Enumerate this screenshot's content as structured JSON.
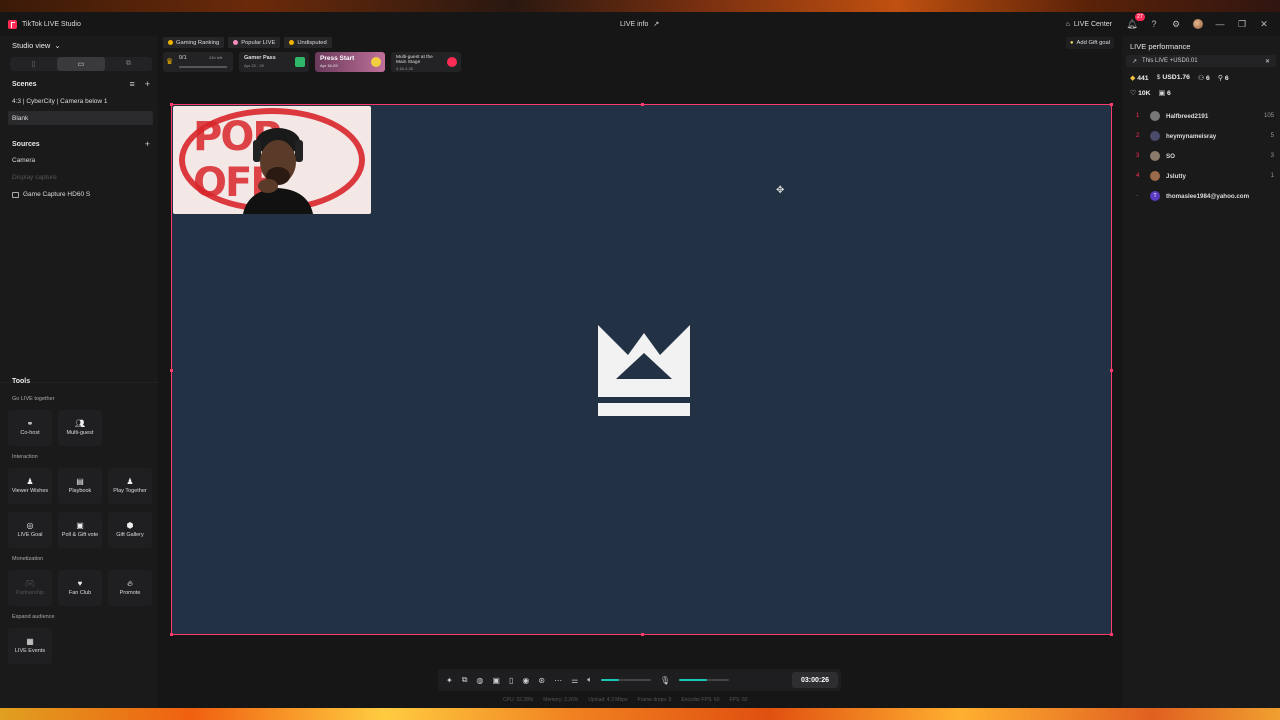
{
  "app": {
    "title": "TikTok LIVE Studio",
    "center_title": "LIVE info"
  },
  "titlebar": {
    "live_center": "LIVE Center",
    "notification_count": "27"
  },
  "sidebar": {
    "studio_view": "Studio view",
    "scenes_title": "Scenes",
    "scenes": [
      "4:3 | CyberCity | Camera below 1",
      "Blank"
    ],
    "sources_title": "Sources",
    "sources": [
      "Camera",
      "Display capture",
      "Game Capture HD60 S"
    ]
  },
  "tools": {
    "title": "Tools",
    "go_live_together": "Go LIVE together",
    "cohost": "Co-host",
    "multiguest": "Multi-guest",
    "interaction": "Interaction",
    "viewer_wishes": "Viewer Wishes",
    "playbook": "Playbook",
    "play_together": "Play Together",
    "live_goal": "LIVE Goal",
    "poll_gift": "Poll & Gift vote",
    "gift_gallery": "Gift Gallery",
    "monetization": "Monetization",
    "partnership": "Partnership",
    "fan_club": "Fan Club",
    "promote": "Promote",
    "expand_audience": "Expand audience",
    "live_events": "LIVE Events"
  },
  "topbar": {
    "chips": [
      "Gaming Ranking",
      "Popular LIVE",
      "Undisputed"
    ],
    "banner1_value": "0/1",
    "banner1_note": "24h left",
    "banner2_title": "Gamer Pass",
    "banner2_sub": "Apr 23 - 29",
    "banner3_title": "Press Start",
    "banner3_sub": "Apr 16-29",
    "banner4_title": "Multi-guest at the Main Stage",
    "banner4_sub": "4.16-4.26",
    "gift_goal": "Add Gift goal"
  },
  "canvas": {
    "overlay_text": "POP OFF",
    "background": "#223144",
    "border_color": "#ff3b6b"
  },
  "bottombar": {
    "timer": "03:00:26",
    "volume_level": 0.35,
    "mic_level": 0.55,
    "stats": [
      "CPU: 32.28%",
      "Memory: 2.26%",
      "Upload: 4.3 Mbps",
      "Frame drops: 0",
      "Encoder FPS: 60",
      "FPS: 60"
    ]
  },
  "right_panel": {
    "title": "LIVE performance",
    "this_live": "This LIVE +USD0.01",
    "metrics": {
      "diamonds": "441",
      "usd": "USD1.76",
      "viewers": "6",
      "shares": "6",
      "likes": "10K",
      "gifters": "6"
    },
    "viewers": [
      {
        "rank": "1",
        "name": "Halfbreed2191",
        "score": "105"
      },
      {
        "rank": "2",
        "name": "heymynameisray",
        "score": "5"
      },
      {
        "rank": "3",
        "name": "SO",
        "score": "3"
      },
      {
        "rank": "4",
        "name": "Jslutty",
        "score": "1"
      },
      {
        "rank": "-",
        "name": "thomaslee1984@yahoo.com",
        "score": ""
      }
    ]
  },
  "colors": {
    "accent": "#fe2c55",
    "teal": "#19c6b4"
  }
}
